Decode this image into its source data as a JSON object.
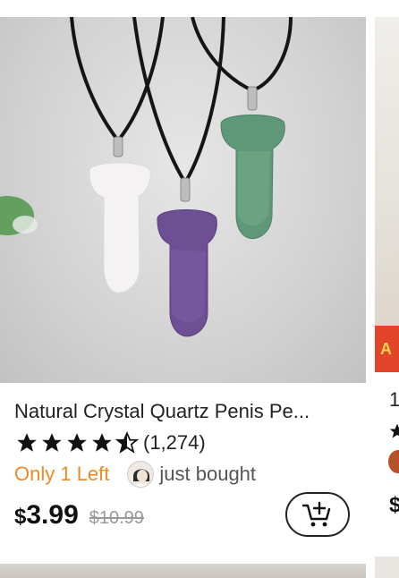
{
  "product": {
    "title": "Natural Crystal Quartz Penis Pe...",
    "rating": 4.5,
    "rating_count": "(1,274)",
    "stock_text": "Only 1 Left",
    "bought_text": "just bought",
    "currency": "$",
    "price": "3.99",
    "original_price": "$10.99",
    "image_icon": "crystal-pendant-necklaces-photo",
    "cart_icon": "add-to-cart-icon"
  },
  "neighbor_card": {
    "title_start": "1",
    "banner_text": "A",
    "price_start": "$"
  },
  "colors": {
    "stock": "#f08a24",
    "price": "#111111",
    "old_price": "#999999",
    "star": "#111111"
  }
}
